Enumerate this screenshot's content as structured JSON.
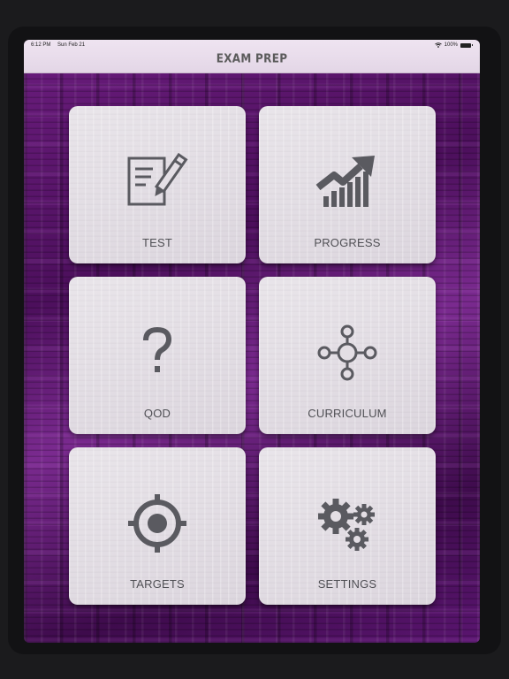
{
  "status_bar": {
    "time": "6:12 PM",
    "date": "Sun Feb 21",
    "battery": "100%"
  },
  "header": {
    "title": "EXAM PREP"
  },
  "tiles": [
    {
      "label": "TEST",
      "icon": "test-icon"
    },
    {
      "label": "PROGRESS",
      "icon": "progress-icon"
    },
    {
      "label": "QOD",
      "icon": "question-mark-icon"
    },
    {
      "label": "CURRICULUM",
      "icon": "curriculum-icon"
    },
    {
      "label": "TARGETS",
      "icon": "target-icon"
    },
    {
      "label": "SETTINGS",
      "icon": "gears-icon"
    }
  ],
  "colors": {
    "background": "#5a1570",
    "tile": "#e2dde3",
    "icon": "#5a5a60",
    "header": "#e9dcec"
  }
}
